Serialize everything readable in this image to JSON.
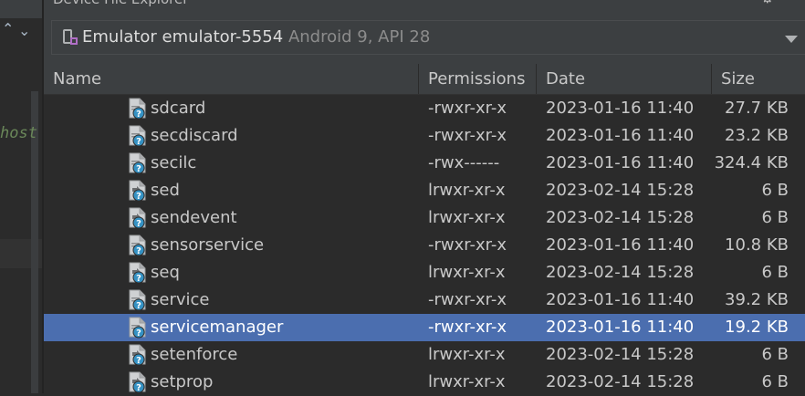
{
  "panel": {
    "title": "Device File Explorer"
  },
  "device": {
    "name": "Emulator emulator-5554",
    "api": "Android 9, API 28"
  },
  "editor_fragment": {
    "text": "host"
  },
  "columns": [
    "Name",
    "Permissions",
    "Date",
    "Size"
  ],
  "rows": [
    {
      "name": "sdcard",
      "perm": "-rwxr-xr-x",
      "date": "2023-01-16 11:40",
      "size": "27.7 KB",
      "icon": "file-unknown-icon",
      "selected": false
    },
    {
      "name": "secdiscard",
      "perm": "-rwxr-xr-x",
      "date": "2023-01-16 11:40",
      "size": "23.2 KB",
      "icon": "file-unknown-icon",
      "selected": false
    },
    {
      "name": "secilc",
      "perm": "-rwx------",
      "date": "2023-01-16 11:40",
      "size": "324.4 KB",
      "icon": "file-unknown-icon",
      "selected": false
    },
    {
      "name": "sed",
      "perm": "lrwxr-xr-x",
      "date": "2023-02-14 15:28",
      "size": "6 B",
      "icon": "file-link-icon",
      "selected": false
    },
    {
      "name": "sendevent",
      "perm": "lrwxr-xr-x",
      "date": "2023-02-14 15:28",
      "size": "6 B",
      "icon": "file-link-icon",
      "selected": false
    },
    {
      "name": "sensorservice",
      "perm": "-rwxr-xr-x",
      "date": "2023-01-16 11:40",
      "size": "10.8 KB",
      "icon": "file-unknown-icon",
      "selected": false
    },
    {
      "name": "seq",
      "perm": "lrwxr-xr-x",
      "date": "2023-02-14 15:28",
      "size": "6 B",
      "icon": "file-link-icon",
      "selected": false
    },
    {
      "name": "service",
      "perm": "-rwxr-xr-x",
      "date": "2023-01-16 11:40",
      "size": "39.2 KB",
      "icon": "file-unknown-icon",
      "selected": false
    },
    {
      "name": "servicemanager",
      "perm": "-rwxr-xr-x",
      "date": "2023-01-16 11:40",
      "size": "19.2 KB",
      "icon": "file-unknown-icon",
      "selected": true
    },
    {
      "name": "setenforce",
      "perm": "lrwxr-xr-x",
      "date": "2023-02-14 15:28",
      "size": "6 B",
      "icon": "file-link-icon",
      "selected": false
    },
    {
      "name": "setprop",
      "perm": "lrwxr-xr-x",
      "date": "2023-02-14 15:28",
      "size": "6 B",
      "icon": "file-link-icon",
      "selected": false
    }
  ],
  "colors": {
    "selection": "#4b6eaf",
    "background": "#2b2b2b",
    "panel": "#3c3f41",
    "icon_blue": "#3592c4"
  }
}
